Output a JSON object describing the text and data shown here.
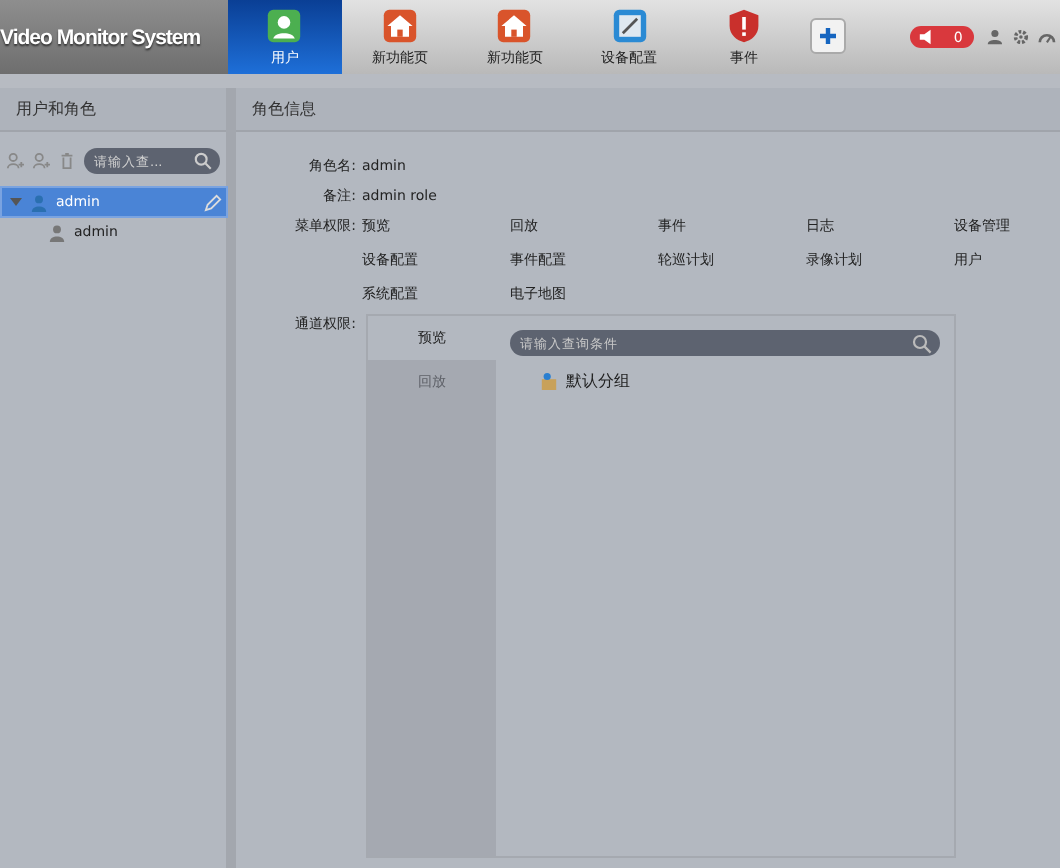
{
  "app": {
    "title": "Video Monitor System"
  },
  "tabs": [
    {
      "label": "用户",
      "selected": true,
      "kind": "user"
    },
    {
      "label": "新功能页",
      "selected": false,
      "kind": "home"
    },
    {
      "label": "新功能页",
      "selected": false,
      "kind": "home"
    },
    {
      "label": "设备配置",
      "selected": false,
      "kind": "config"
    },
    {
      "label": "事件",
      "selected": false,
      "kind": "alert"
    }
  ],
  "alarm": {
    "count": "0"
  },
  "left_panel": {
    "title": "用户和角色",
    "search": {
      "placeholder": "请输入查..."
    },
    "tree": [
      {
        "label": "admin",
        "kind": "role",
        "expanded": true,
        "selected": true,
        "children": [
          {
            "label": "admin",
            "kind": "user",
            "selected": false
          }
        ]
      }
    ]
  },
  "right_panel": {
    "title": "角色信息",
    "fields": [
      {
        "label": "角色名:",
        "value": "admin"
      },
      {
        "label": "备注:",
        "value": "admin role"
      }
    ],
    "menu_permissions": {
      "label": "菜单权限:",
      "items": [
        "预览",
        "回放",
        "事件",
        "日志",
        "设备管理",
        "设备配置",
        "事件配置",
        "轮巡计划",
        "录像计划",
        "用户",
        "系统配置",
        "电子地图"
      ]
    },
    "channel_permissions": {
      "label": "通道权限:",
      "tabs": [
        {
          "label": "预览",
          "selected": true
        },
        {
          "label": "回放",
          "selected": false
        }
      ],
      "search": {
        "placeholder": "请输入查询条件"
      },
      "groups": [
        "默认分组"
      ]
    }
  }
}
